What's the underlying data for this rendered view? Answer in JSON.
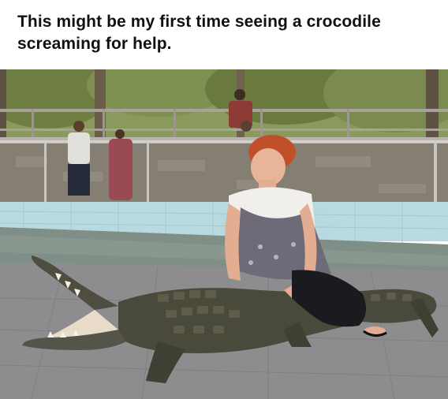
{
  "caption": {
    "text": "This might be my first time seeing a crocodile screaming for help."
  },
  "photo": {
    "subject_icons": [
      "crocodile-icon",
      "person-icon",
      "fence-icon",
      "trees-icon",
      "pool-icon"
    ],
    "colors": {
      "trees": "#7b8a4e",
      "fence_wall": "#8b8478",
      "pool_tiles": "#b9d9e0",
      "water": "#7f8e86",
      "crocodile": "#4a4a3c",
      "floor": "#8d8c8f",
      "hair": "#c0502a",
      "shirt": "#f1efec",
      "pants": "#1a1a1f"
    }
  }
}
